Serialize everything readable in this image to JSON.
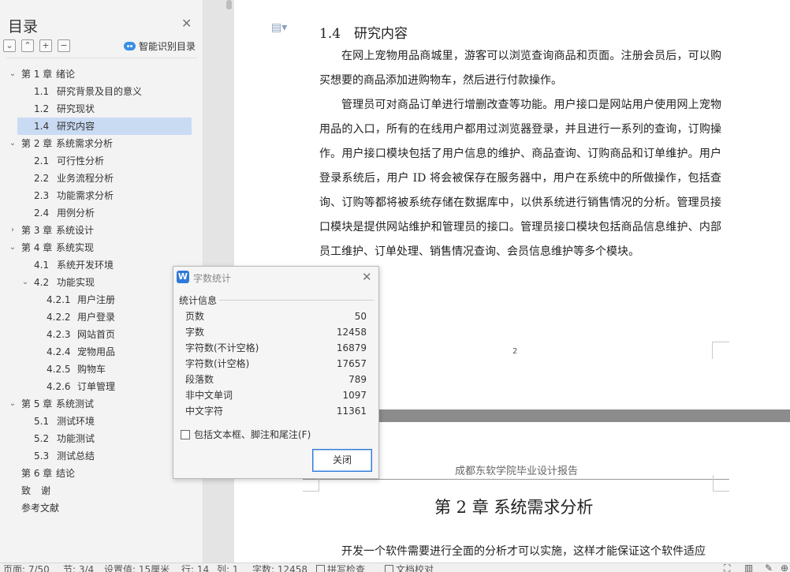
{
  "sidebar": {
    "title": "目录",
    "smart_label": "智能识别目录",
    "toc": [
      {
        "level": 1,
        "arrow": "v",
        "num": "第 1 章",
        "text": "绪论"
      },
      {
        "level": 2,
        "arrow": "",
        "num": "1.1",
        "text": "研究背景及目的意义"
      },
      {
        "level": 2,
        "arrow": "",
        "num": "1.2",
        "text": "研究现状"
      },
      {
        "level": 2,
        "arrow": "",
        "num": "1.4",
        "text": "研究内容",
        "active": true
      },
      {
        "level": 1,
        "arrow": "v",
        "num": "第 2 章",
        "text": "系统需求分析"
      },
      {
        "level": 2,
        "arrow": "",
        "num": "2.1",
        "text": "可行性分析"
      },
      {
        "level": 2,
        "arrow": "",
        "num": "2.2",
        "text": "业务流程分析"
      },
      {
        "level": 2,
        "arrow": "",
        "num": "2.3",
        "text": "功能需求分析"
      },
      {
        "level": 2,
        "arrow": "",
        "num": "2.4",
        "text": "用例分析"
      },
      {
        "level": 1,
        "arrow": ">",
        "num": "第 3 章",
        "text": "系统设计"
      },
      {
        "level": 1,
        "arrow": "v",
        "num": "第 4 章",
        "text": "系统实现"
      },
      {
        "level": 2,
        "arrow": "",
        "num": "4.1",
        "text": "系统开发环境"
      },
      {
        "level": 2,
        "arrow": "v",
        "num": "4.2",
        "text": "功能实现"
      },
      {
        "level": 3,
        "arrow": "",
        "num": "4.2.1",
        "text": "用户注册"
      },
      {
        "level": 3,
        "arrow": "",
        "num": "4.2.2",
        "text": "用户登录"
      },
      {
        "level": 3,
        "arrow": "",
        "num": "4.2.3",
        "text": "网站首页"
      },
      {
        "level": 3,
        "arrow": "",
        "num": "4.2.4",
        "text": "宠物用品"
      },
      {
        "level": 3,
        "arrow": "",
        "num": "4.2.5",
        "text": "购物车"
      },
      {
        "level": 3,
        "arrow": "",
        "num": "4.2.6",
        "text": "订单管理"
      },
      {
        "level": 1,
        "arrow": "v",
        "num": "第 5 章",
        "text": "系统测试"
      },
      {
        "level": 2,
        "arrow": "",
        "num": "5.1",
        "text": "测试环境"
      },
      {
        "level": 2,
        "arrow": "",
        "num": "5.2",
        "text": "功能测试"
      },
      {
        "level": 2,
        "arrow": "",
        "num": "5.3",
        "text": "测试总结"
      },
      {
        "level": 1,
        "arrow": "",
        "num": "第 6 章",
        "text": "结论"
      },
      {
        "level": 1,
        "arrow": "",
        "num": "致",
        "text": "谢"
      },
      {
        "level": 1,
        "arrow": "",
        "num": "参考文献",
        "text": ""
      }
    ]
  },
  "document": {
    "section_heading": "1.4　研究内容",
    "para1": "在网上宠物用品商城里，游客可以浏览查询商品和页面。注册会员后，可以购买想要的商品添加进购物车，然后进行付款操作。",
    "para2": "管理员可对商品订单进行增删改查等功能。用户接口是网站用户使用网上宠物用品的入口，所有的在线用户都用过浏览器登录，并且进行一系列的查询，订购操作。用户接口模块包括了用户信息的维护、商品查询、订购商品和订单维护。用户登录系统后，用户 ID 将会被保存在服务器中，用户在系统中的所做操作，包括查询、订购等都将被系统存储在数据库中，以供系统进行销售情况的分析。管理员接口模块是提供网站维护和管理员的接口。管理员接口模块包括商品信息维护、内部员工维护、订单处理、销售情况查询、会员信息维护等多个模块。",
    "page_number": "2",
    "page2_header": "成都东软学院毕业设计报告",
    "chapter2_title": "第 2 章  系统需求分析",
    "page2_para": "开发一个软件需要进行全面的分析才可以实施，这样才能保证这个软件适应"
  },
  "dialog": {
    "title": "字数统计",
    "section": "统计信息",
    "stats": [
      {
        "label": "页数",
        "value": "50"
      },
      {
        "label": "字数",
        "value": "12458"
      },
      {
        "label": "字符数(不计空格)",
        "value": "16879"
      },
      {
        "label": "字符数(计空格)",
        "value": "17657"
      },
      {
        "label": "段落数",
        "value": "789"
      },
      {
        "label": "非中文单词",
        "value": "1097"
      },
      {
        "label": "中文字符",
        "value": "11361"
      }
    ],
    "checkbox_label": "包括文本框、脚注和尾注(F)",
    "checkbox_checked": false,
    "close_label": "关闭"
  },
  "statusbar": {
    "page": "页面: 7/50",
    "section": "节: 3/4",
    "setting": "设置值: 15厘米",
    "row": "行: 14",
    "col": "列: 1",
    "words": "字数: 12458",
    "spell": "拼写检查",
    "proof": "文档校对"
  }
}
